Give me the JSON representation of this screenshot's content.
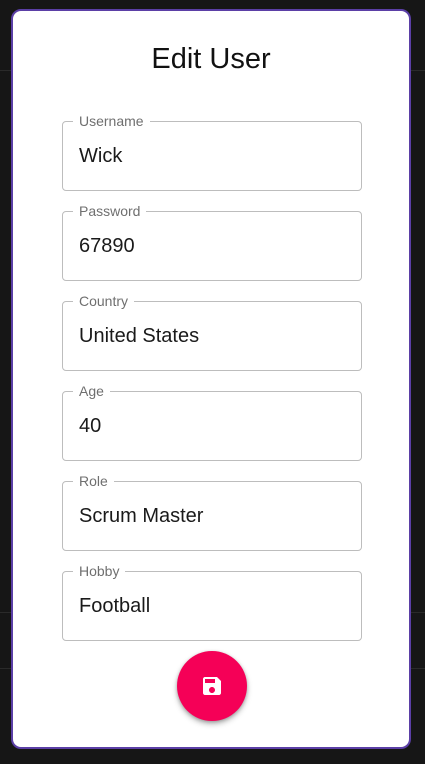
{
  "dialog": {
    "title": "Edit User"
  },
  "fields": [
    {
      "label": "Username",
      "value": "Wick"
    },
    {
      "label": "Password",
      "value": "67890"
    },
    {
      "label": "Country",
      "value": "United States"
    },
    {
      "label": "Age",
      "value": "40"
    },
    {
      "label": "Role",
      "value": "Scrum Master"
    },
    {
      "label": "Hobby",
      "value": "Football"
    }
  ],
  "save_button": {
    "icon": "save-icon",
    "color": "#f50057"
  },
  "colors": {
    "dialog_border": "#5b3fa6",
    "field_border": "#bdbdbd",
    "label": "#6f6f6f"
  }
}
